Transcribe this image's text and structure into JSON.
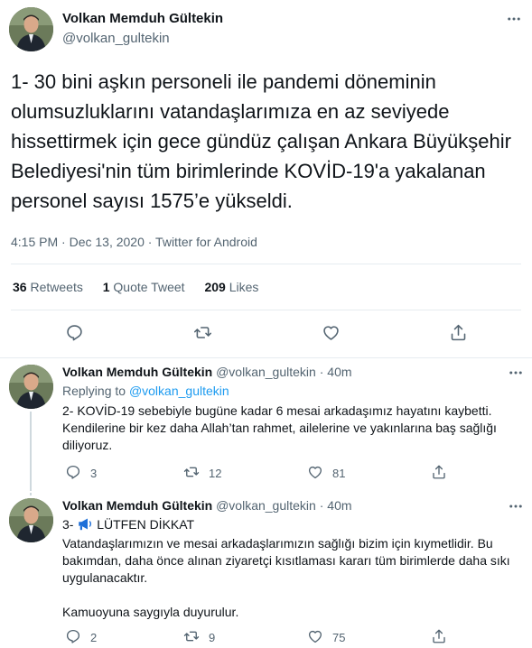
{
  "main_tweet": {
    "author_name": "Volkan Memduh Gültekin",
    "author_handle": "@volkan_gultekin",
    "text": "1- 30 bini aşkın personeli ile pandemi döneminin olumsuzluklarını vatandaşlarımıza en az seviyede hissettirmek için gece gündüz çalışan Ankara Büyükşehir Belediyesi'nin tüm birimlerinde KOVİD-19'a yakalanan personel sayısı 1575’e yükseldi.",
    "meta": "4:15 PM · Dec 13, 2020 · Twitter for Android",
    "stats": {
      "retweets_count": "36",
      "retweets_label": "Retweets",
      "quotes_count": "1",
      "quotes_label": "Quote Tweet",
      "likes_count": "209",
      "likes_label": "Likes"
    }
  },
  "replies": [
    {
      "author_name": "Volkan Memduh Gültekin",
      "author_handle": "@volkan_gultekin",
      "time": "40m",
      "replying_prefix": "Replying to",
      "replying_handle": "@volkan_gultekin",
      "text": "2- KOVİD-19 sebebiyle bugüne kadar 6 mesai arkadaşımız hayatını kaybetti. Kendilerine bir kez daha Allah’tan rahmet, ailelerine ve yakınlarına baş sağlığı diliyoruz.",
      "reply_count": "3",
      "retweet_count": "12",
      "like_count": "81"
    },
    {
      "author_name": "Volkan Memduh Gültekin",
      "author_handle": "@volkan_gultekin",
      "time": "40m",
      "text_title": "3- 📢 LÜTFEN DİKKAT",
      "text_prefix": "3-",
      "text_heading": "LÜTFEN DİKKAT",
      "text_paragraph": "Vatandaşlarımızın ve mesai arkadaşlarımızın sağlığı bizim için kıymetlidir. Bu bakımdan, daha önce alınan ziyaretçi kısıtlaması kararı tüm birimlerde daha sıkı uygulanacaktır.",
      "text_closing": "Kamuoyuna saygıyla duyurulur.",
      "reply_count": "2",
      "retweet_count": "9",
      "like_count": "75"
    }
  ],
  "icons": {
    "reply": "reply-icon",
    "retweet": "retweet-icon",
    "like": "heart-icon",
    "share": "share-icon",
    "more": "more-icon",
    "megaphone": "megaphone-icon"
  },
  "colors": {
    "text_primary": "#0f1419",
    "text_secondary": "#536471",
    "link": "#1d9bf0",
    "divider": "#e6ecf0"
  }
}
